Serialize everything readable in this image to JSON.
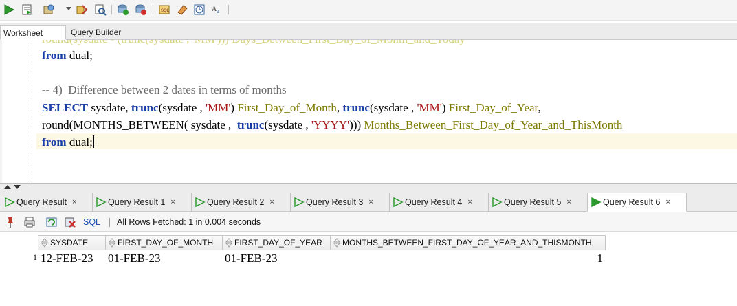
{
  "toolbar": {
    "icons": [
      "run-statement-icon",
      "run-script-icon",
      "commit-icon",
      "dropdown-caret-icon",
      "autotrace-icon",
      "explain-plan-icon",
      "commit-green-icon",
      "rollback-icon",
      "sql-tuning-icon",
      "clear-eraser-icon",
      "history-icon",
      "format-icon"
    ]
  },
  "editor_tabs": [
    {
      "label": "Worksheet",
      "active": true
    },
    {
      "label": "Query Builder",
      "active": false
    }
  ],
  "editor": {
    "partial_top_line": "round(sysdate - (trunc(sysdate , 'MM'))) Days_Between_First_Day_of_Month_and_Today",
    "lines": [
      {
        "parts": [
          {
            "t": "from",
            "c": "kw"
          },
          {
            "t": " dual;",
            "c": "plain"
          }
        ]
      },
      {
        "parts": []
      },
      {
        "parts": [
          {
            "t": "-- 4)  Difference between 2 dates in terms of months",
            "c": "cmt"
          }
        ]
      },
      {
        "parts": [
          {
            "t": "SELECT",
            "c": "kw"
          },
          {
            "t": " sysdate, ",
            "c": "plain"
          },
          {
            "t": "trunc",
            "c": "kw"
          },
          {
            "t": "(sysdate , ",
            "c": "plain"
          },
          {
            "t": "'MM'",
            "c": "str"
          },
          {
            "t": ") ",
            "c": "plain"
          },
          {
            "t": "First_Day_of_Month",
            "c": "alias"
          },
          {
            "t": ", ",
            "c": "plain"
          },
          {
            "t": "trunc",
            "c": "kw"
          },
          {
            "t": "(sysdate , ",
            "c": "plain"
          },
          {
            "t": "'MM'",
            "c": "str"
          },
          {
            "t": ") ",
            "c": "plain"
          },
          {
            "t": "First_Day_of_Year",
            "c": "alias"
          },
          {
            "t": ",",
            "c": "plain"
          }
        ]
      },
      {
        "parts": [
          {
            "t": "round",
            "c": "fn"
          },
          {
            "t": "(MONTHS_BETWEEN( sysdate ,  ",
            "c": "plain"
          },
          {
            "t": "trunc",
            "c": "kw"
          },
          {
            "t": "(sysdate , ",
            "c": "plain"
          },
          {
            "t": "'YYYY'",
            "c": "str"
          },
          {
            "t": "))) ",
            "c": "plain"
          },
          {
            "t": "Months_Between_First_Day_of_Year_and_ThisMonth",
            "c": "alias"
          }
        ]
      },
      {
        "parts": [
          {
            "t": "from",
            "c": "kw"
          },
          {
            "t": " dual;",
            "c": "plain"
          }
        ],
        "cursor": true
      }
    ]
  },
  "result_tabs": [
    {
      "label": "Query Result",
      "close": "×",
      "active": false
    },
    {
      "label": "Query Result 1",
      "close": "×",
      "active": false
    },
    {
      "label": "Query Result 2",
      "close": "×",
      "active": false
    },
    {
      "label": "Query Result 3",
      "close": "×",
      "active": false
    },
    {
      "label": "Query Result 4",
      "close": "×",
      "active": false
    },
    {
      "label": "Query Result 5",
      "close": "×",
      "active": false
    },
    {
      "label": "Query Result 6",
      "close": "×",
      "active": true
    }
  ],
  "result_toolbar": {
    "sql_label": "SQL",
    "status": "All Rows Fetched: 1 in 0.004 seconds"
  },
  "grid": {
    "columns": [
      "SYSDATE",
      "FIRST_DAY_OF_MONTH",
      "FIRST_DAY_OF_YEAR",
      "MONTHS_BETWEEN_FIRST_DAY_OF_YEAR_AND_THISMONTH"
    ],
    "rows": [
      {
        "num": "1",
        "cells": [
          "12-FEB-23",
          "01-FEB-23",
          "01-FEB-23",
          "1"
        ]
      }
    ]
  },
  "colors": {
    "keyword": "#1a3ea8",
    "string": "#a61414",
    "alias": "#7d7a00",
    "comment": "#6b6b6b",
    "run_green": "#2e9a2e"
  }
}
